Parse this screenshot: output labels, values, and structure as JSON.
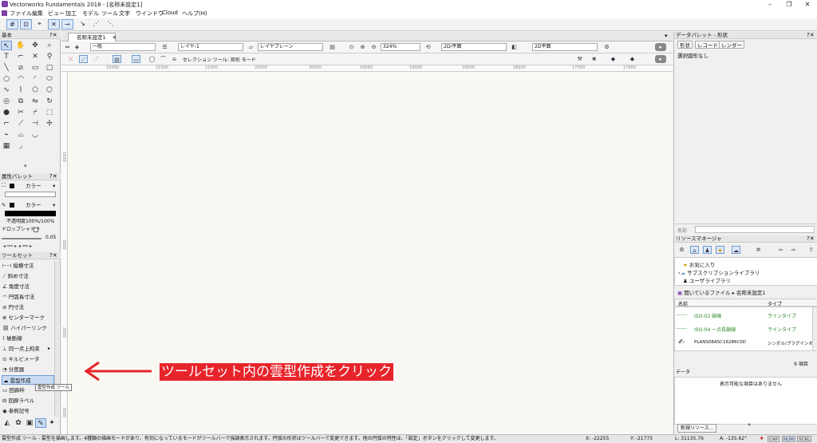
{
  "app": {
    "title": "Vectorworks Fundamentals 2018 - [名称未設定1]"
  },
  "menu": [
    "ファイル",
    "編集",
    "ビュー",
    "加工",
    "モデル",
    "ツール",
    "文字",
    "ウインドウ",
    "Cloud",
    "ヘルプ(H)"
  ],
  "left": {
    "basic_title": "基本",
    "attr_title": "属性パレット",
    "fill_label": "カラー",
    "pen_label": "カラー",
    "opacity": "不透明度100%/100%",
    "dropshadow": "ドロップシャドウ",
    "line_weight": "0.05",
    "toolset_title": "ツールセット",
    "toolset_items": [
      "縦横寸法",
      "斜め寸法",
      "角度寸法",
      "円弧長寸法",
      "円寸法",
      "センターマーク",
      "ハイパーリンク",
      "破断線",
      "同一点上拘束",
      "キルビメータ",
      "分度器",
      "雲型作成",
      "回廊枠",
      "回廊ラベル",
      "参照記号"
    ],
    "tooltip": "雲型作成 ツール"
  },
  "doc": {
    "tab": "名称未設定1",
    "class": "一般",
    "layer": "レイヤ-1",
    "layerplane": "レイヤプレーン",
    "zoom": "324%",
    "view": "2D/平面",
    "render": "2D平面",
    "mode_text": "セレクション ツール: 矩形 モード",
    "ruler_labels": [
      "22000",
      "21500",
      "21000",
      "20500",
      "20000",
      "19500",
      "19000",
      "18500",
      "18000",
      "17500",
      "17000"
    ],
    "vruler_labels": [
      "1500",
      "2000",
      "2500",
      "3000"
    ]
  },
  "annotation": "ツールセット内の雲型作成をクリック",
  "right": {
    "data_palette": "データパレット - 形状",
    "tabs": [
      "形状",
      "レコード",
      "レンダー"
    ],
    "no_selection": "選択図形なし",
    "name_label": "名前",
    "rm_title": "リソースマネージャ",
    "rm_tree": [
      "お気に入り",
      "サブスクリプションライブラリ",
      "ユーザライブラリ"
    ],
    "rm_path": "開いているファイル ▸ 名称未設定1",
    "col_name": "名前",
    "col_type": "タイプ",
    "resources": [
      {
        "name": "ISO-02 破線",
        "type": "ラインタイプ"
      },
      {
        "name": "ISO-04 一点長鎖線",
        "type": "ラインタイプ"
      },
      {
        "name": "PLANS08ASC16286C0D",
        "type": "シンボル/プラグインオブ"
      }
    ],
    "count": "9 項目",
    "data_title": "データ",
    "data_empty": "表示可能な項目はありません",
    "new_resource": "新規リソース..."
  },
  "status": {
    "help": "雲型作成 ツール - 雲型を描画します。4種類の描画モードがあり、有効になっているモードがツールバーで強調表示されます。円弧の形状はツールバーで変更できます。他の円弧の特性は、「設定」ボタンをクリックして変更します。",
    "x": "X: -22255",
    "y": "Y: -21775",
    "l": "L: 31135.76",
    "a": "A: -135.62°",
    "badges": [
      "CAP",
      "NUM",
      "SCRL"
    ]
  },
  "colors": {
    "accent": "#6f9bd1",
    "annotation": "#e8242b"
  }
}
